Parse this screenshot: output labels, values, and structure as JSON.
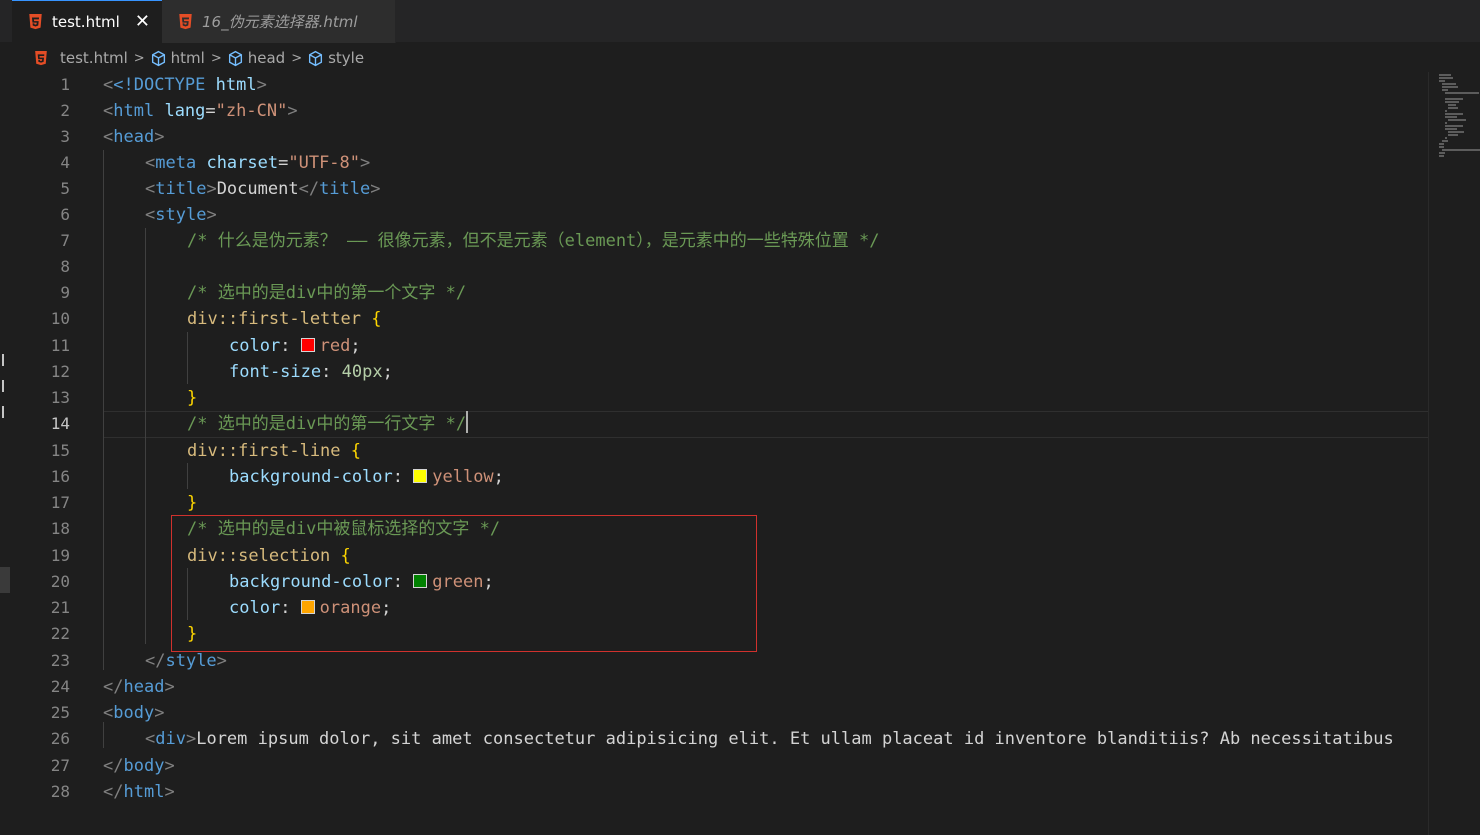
{
  "tabs": [
    {
      "label": "test.html",
      "active": true,
      "close": "✕"
    },
    {
      "label": "16_伪元素选择器.html",
      "active": false
    }
  ],
  "breadcrumb": {
    "file": "test.html",
    "items": [
      "html",
      "head",
      "style"
    ],
    "separator": ">"
  },
  "editor": {
    "current_line": 14,
    "line_numbers": [
      "1",
      "2",
      "3",
      "4",
      "5",
      "6",
      "7",
      "8",
      "9",
      "10",
      "11",
      "12",
      "13",
      "14",
      "15",
      "16",
      "17",
      "18",
      "19",
      "20",
      "21",
      "22",
      "23",
      "24",
      "25",
      "26",
      "27",
      "28"
    ],
    "code": {
      "l1_doctype": "<!DOCTYPE",
      "l1_html": "html",
      "l2_tag": "html",
      "l2_attr": "lang",
      "l2_val": "\"zh-CN\"",
      "l3_tag": "head",
      "l4_tag": "meta",
      "l4_attr": "charset",
      "l4_val": "\"UTF-8\"",
      "l5_tag": "title",
      "l5_text": "Document",
      "l6_tag": "style",
      "l7_comment": "/* 什么是伪元素？ —— 很像元素，但不是元素（element），是元素中的一些特殊位置 */",
      "l9_comment": "/* 选中的是div中的第一个文字 */",
      "l10_selector": "div::first-letter",
      "l11_prop": "color",
      "l11_val": "red",
      "l12_prop": "font-size",
      "l12_val": "40px",
      "l14_comment": "/* 选中的是div中的第一行文字 */",
      "l15_selector": "div::first-line",
      "l16_prop": "background-color",
      "l16_val": "yellow",
      "l18_comment": "/* 选中的是div中被鼠标选择的文字 */",
      "l19_selector": "div::selection",
      "l20_prop": "background-color",
      "l20_val": "green",
      "l21_prop": "color",
      "l21_val": "orange",
      "l23_tag": "style",
      "l24_tag": "head",
      "l25_tag": "body",
      "l26_tag": "div",
      "l26_text": "Lorem ipsum dolor, sit amet consectetur adipisicing elit. Et ullam placeat id inventore blanditiis? Ab necessitatibus",
      "l27_tag": "body",
      "l28_tag": "html"
    }
  },
  "colors": {
    "red": "#ff0000",
    "yellow": "#ffff00",
    "green": "#008000",
    "orange": "#ffa500",
    "highlight_border": "#d0312d"
  }
}
